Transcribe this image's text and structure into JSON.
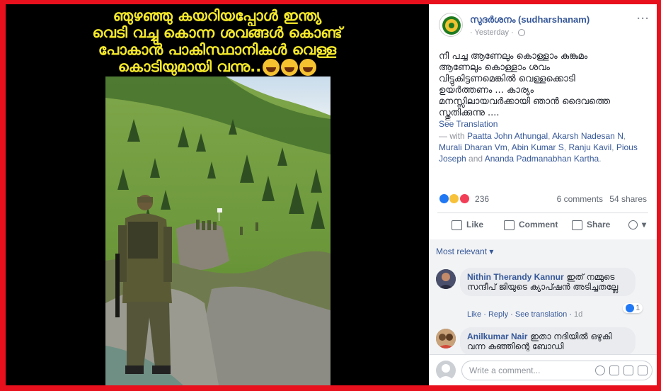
{
  "meme": {
    "caption_lines": [
      "ഞുഴഞ്ഞു കയറിയപ്പോൾ ഇന്ത്യ",
      "വെടി വച്ചു കൊന്ന ശവങ്ങൾ കൊണ്ട്",
      "പോകാൻ പാകിസ്ഥാനികൾ വെള്ള",
      "കൊടിയുമായി വന്നു.."
    ],
    "emojis": [
      "laughing-emoji",
      "rofl-emoji",
      "grinning-emoji"
    ]
  },
  "post": {
    "page_name": "സുദർശനം (sudharshanam)",
    "time": "Yesterday",
    "text_lines": [
      "നീ പച്ച ആണേലും കൊള്ളാം കുങ്കുമം",
      "ആണേലും കൊള്ളാം ശവം",
      "വിട്ടുകിട്ടണമെങ്കിൽ വെള്ളക്കൊടി",
      "ഉയർത്തണം ... കാര്യം",
      "മനസ്സിലായവർക്കായി ഞാൻ ദൈവത്തെ",
      "സ്തുതിക്കുന്നു ...."
    ],
    "see_translation": "See Translation",
    "with_prefix": "— with",
    "tagged": [
      "Paatta John Athungal",
      "Akarsh Nadesan N",
      "Murali Dharan Vm",
      "Abin Kumar S",
      "Ranju Kavil",
      "Pious Joseph",
      "Ananda Padmanabhan Kartha"
    ],
    "reaction_count": "236",
    "comments_count": "6 comments",
    "shares_count": "54 shares"
  },
  "actions": {
    "like": "Like",
    "comment": "Comment",
    "share": "Share"
  },
  "comments_section": {
    "sort_label": "Most relevant ▾",
    "comments": [
      {
        "author": "Nithin Therandy Kannur",
        "text": "ഇത് നമ്മുടെ സന്ദീപ് ജിയുടെ ക്യാപ്ഷൻ അടിച്ചതല്ലേ",
        "like": "Like",
        "reply": "Reply",
        "see_translation": "See translation",
        "age": "1d",
        "likes": "1"
      },
      {
        "author": "Anilkumar Nair",
        "text": "ഇതാ നദിയിൽ ഒഴുകി വന്ന കുഞ്ഞിന്റെ ബോഡി"
      }
    ],
    "write_placeholder": "Write a comment..."
  },
  "colors": {
    "frame": "#e8101c",
    "caption": "#f5e92a",
    "link": "#365899"
  }
}
